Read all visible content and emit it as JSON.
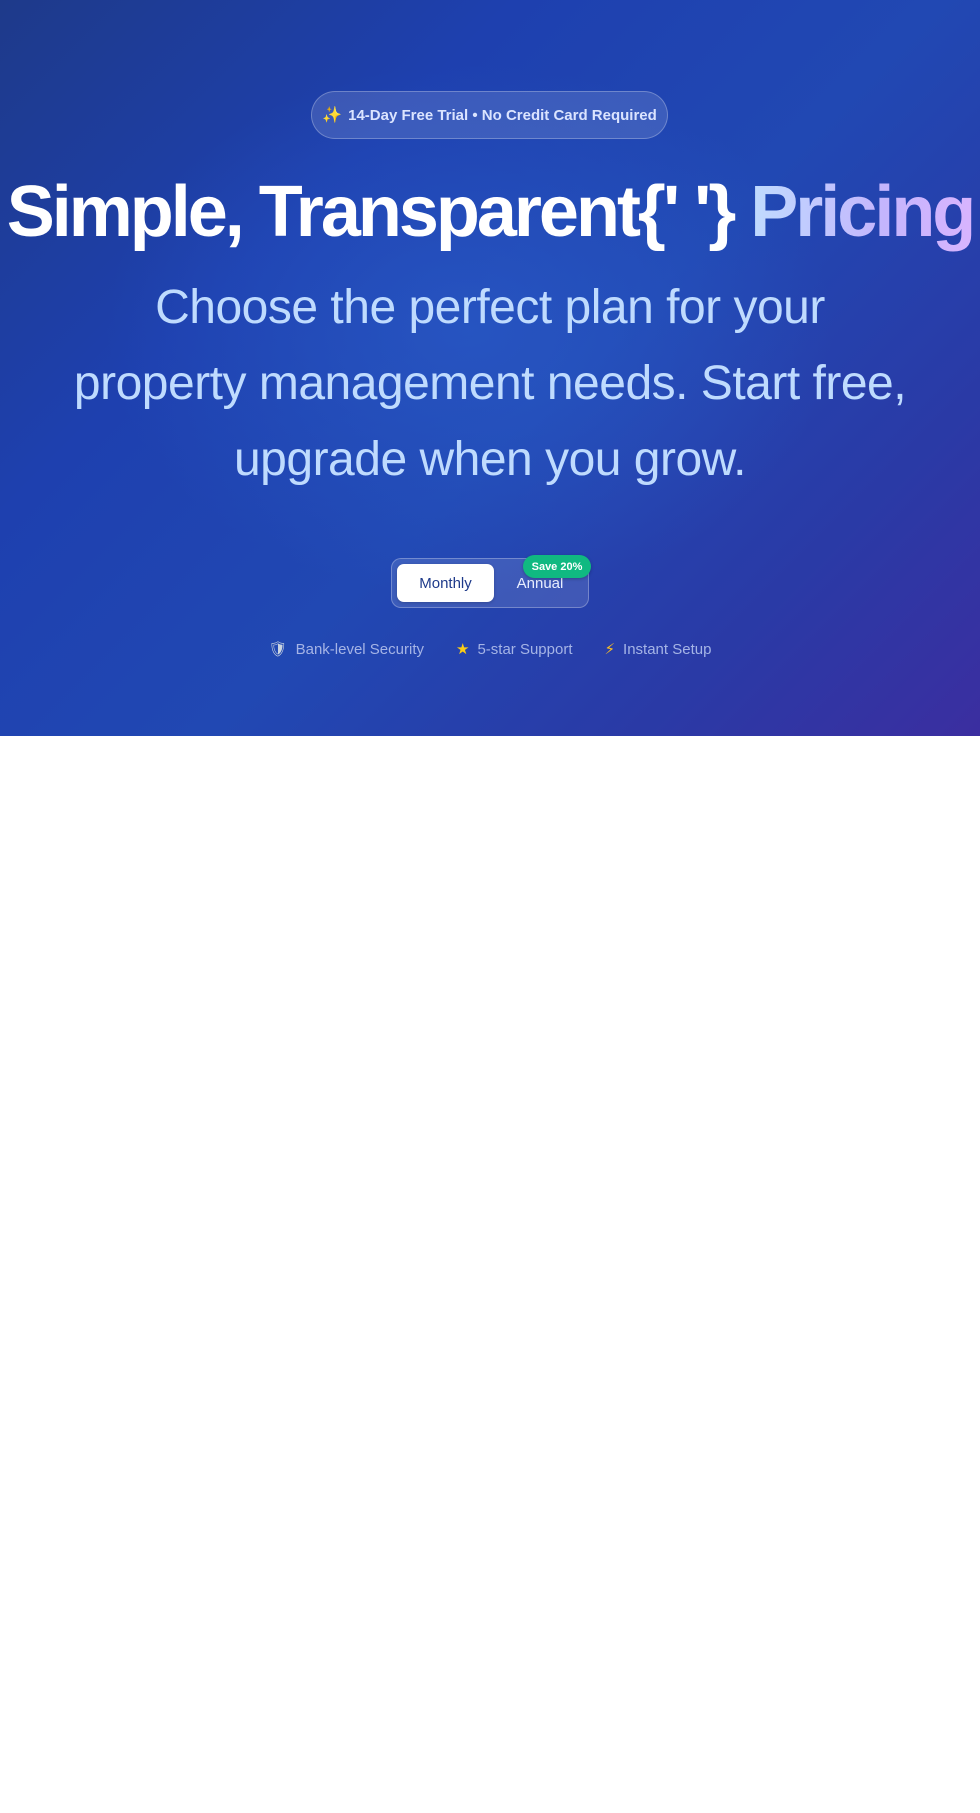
{
  "hero": {
    "trial_badge": {
      "icon": "sparkles-icon",
      "text": "14-Day Free Trial • No Credit Card Required"
    },
    "headline_main": "Simple, Transparent{' '}",
    "headline_accent": "Pricing",
    "subtitle": "Choose the perfect plan for your property management needs. Start free, upgrade when you grow."
  },
  "billing_toggle": {
    "options": [
      "Monthly",
      "Annual"
    ],
    "selected": "Monthly",
    "badge": "Save 20%"
  },
  "trust_items": [
    {
      "icon": "shield-icon",
      "label": "Bank-level Security"
    },
    {
      "icon": "star-icon",
      "label": "5-star Support"
    },
    {
      "icon": "lightning-icon",
      "label": "Instant Setup"
    }
  ],
  "colors": {
    "hero_gradient_start": "#1e3a8a",
    "hero_gradient_end": "#3b2ea0",
    "accent_text": "#c4b5fd",
    "subtitle_text": "#bfdbfe",
    "badge_green": "#10b981",
    "page_background": "#ffffff"
  }
}
